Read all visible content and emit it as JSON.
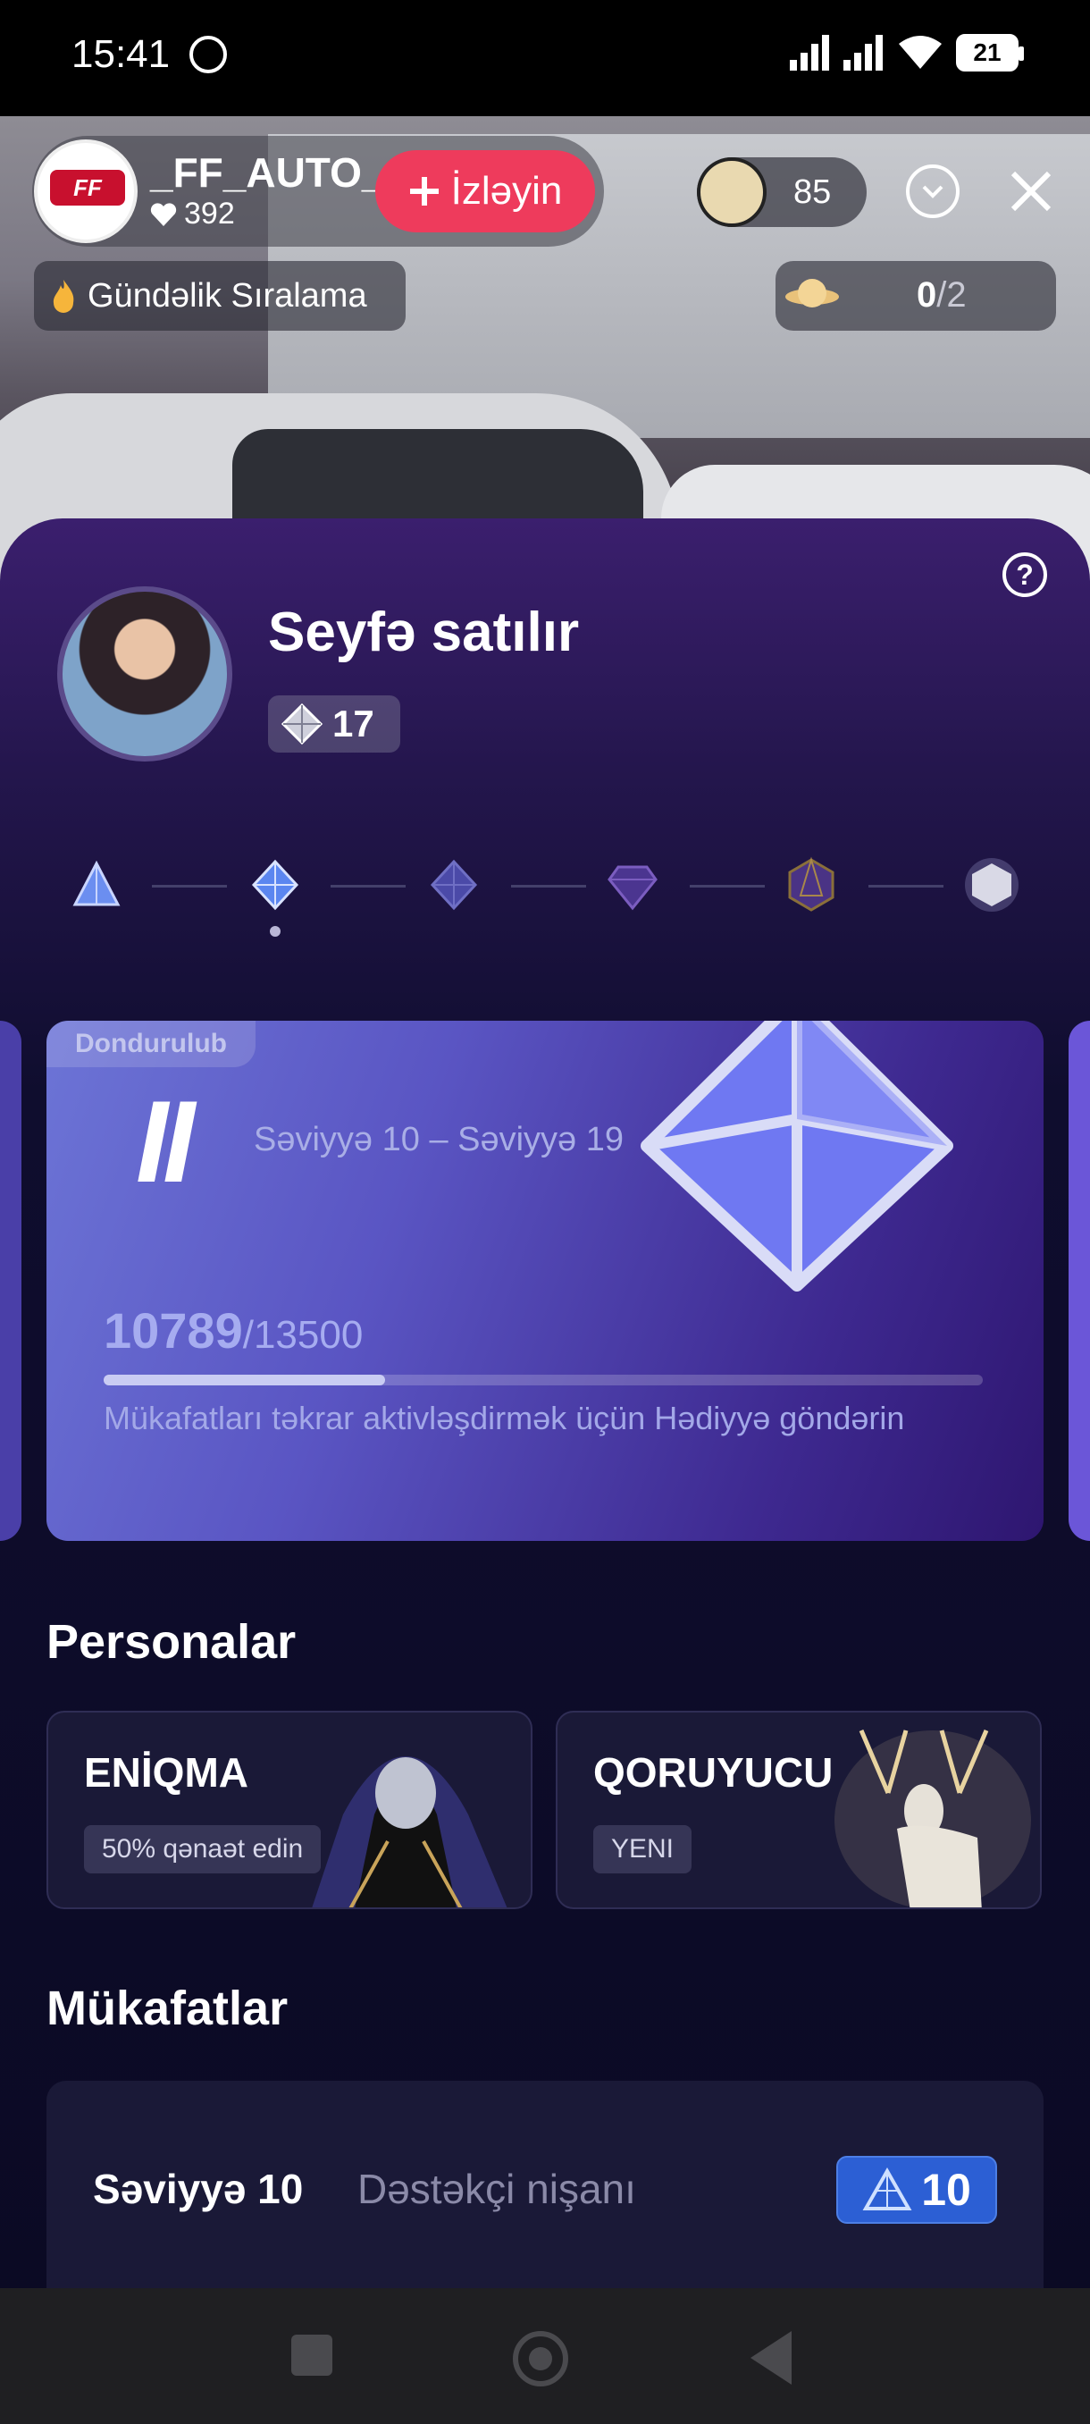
{
  "status_bar": {
    "time": "15:41",
    "battery": "21"
  },
  "live": {
    "host_name": "_FF_AUTO_",
    "host_likes": "392",
    "host_logo_text": "FF AVTO",
    "follow_label": "İzləyin",
    "viewer_count": "85",
    "daily_rank_label": "Gündəlik Sıralama",
    "planet_progress": {
      "current": "0",
      "total": "/2"
    }
  },
  "profile": {
    "name": "Seyfə satılır",
    "badge_value": "17"
  },
  "level_card": {
    "status_tag": "Dondurulub",
    "tier_numeral": "II",
    "range": "Səviyyə 10 – Səviyyə 19",
    "progress_current": "10789",
    "progress_total": "/13500",
    "progress_fraction": 0.32,
    "note": "Mükafatları təkrar aktivləşdirmək üçün Hədiyyə göndərin"
  },
  "personas": {
    "title": "Personalar",
    "items": [
      {
        "name": "ENİQMA",
        "tag": "50% qənaət edin"
      },
      {
        "name": "QORUYUCU",
        "tag": "YENI"
      }
    ]
  },
  "rewards": {
    "title": "Mükafatlar",
    "items": [
      {
        "level": "Səviyyə 10",
        "description": "Dəstəkçi nişanı",
        "badge_value": "10"
      }
    ]
  },
  "colors": {
    "accent_follow": "#ee3b5c",
    "card_start": "#6c74d6",
    "card_end": "#2e1670",
    "reward_badge": "#2c5fd4"
  }
}
